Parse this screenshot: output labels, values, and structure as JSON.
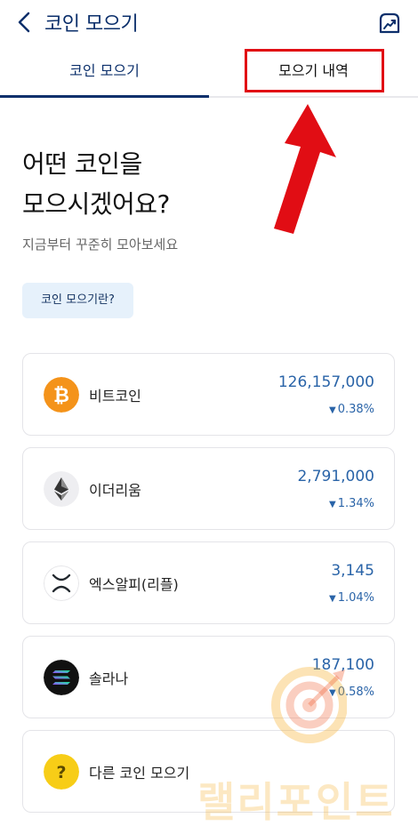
{
  "header": {
    "title": "코인 모으기"
  },
  "tabs": [
    {
      "label": "코인 모으기"
    },
    {
      "label": "모으기 내역"
    }
  ],
  "main": {
    "headline_line1": "어떤 코인을",
    "headline_line2": "모으시겠어요?",
    "subtext": "지금부터 꾸준히 모아보세요",
    "info_button": "코인 모으기란?"
  },
  "coins": [
    {
      "name": "비트코인",
      "price": "126,157,000",
      "change": "0.38%",
      "icon": "bitcoin-icon"
    },
    {
      "name": "이더리움",
      "price": "2,791,000",
      "change": "1.34%",
      "icon": "ethereum-icon"
    },
    {
      "name": "엑스알피(리플)",
      "price": "3,145",
      "change": "1.04%",
      "icon": "xrp-icon"
    },
    {
      "name": "솔라나",
      "price": "187,100",
      "change": "0.58%",
      "icon": "solana-icon"
    }
  ],
  "other": {
    "label": "다른 코인 모으기",
    "icon": "question-icon"
  },
  "watermark": {
    "text": "랠리포인트"
  },
  "colors": {
    "navy": "#0b2f6b",
    "price_blue": "#2a64a8",
    "annotation_red": "#e10d14",
    "bitcoin": "#f4931a"
  }
}
